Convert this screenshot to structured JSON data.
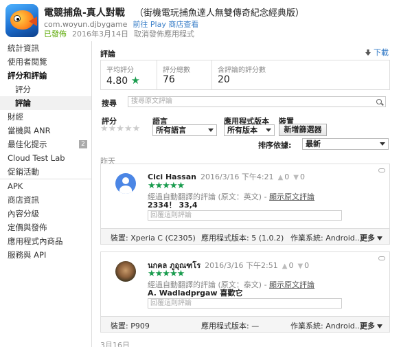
{
  "app": {
    "title": "電競捕魚-真人對戰",
    "subtitle": "（街機電玩捕魚達人無雙傳奇紀念經典版）",
    "package": "com.woyun.djbygame",
    "play_link": "前往 Play 商店查看",
    "status": "已發佈",
    "date": "2016年3月14日",
    "unpublish": "取消發佈應用程式"
  },
  "sidebar": {
    "items": [
      {
        "label": "統計資訊"
      },
      {
        "label": "使用者閱覽"
      },
      {
        "label": "評分和評論"
      },
      {
        "label": "評分"
      },
      {
        "label": "評論"
      },
      {
        "label": "財經"
      },
      {
        "label": "當機與 ANR"
      },
      {
        "label": "最佳化提示",
        "badge": "2"
      },
      {
        "label": "Cloud Test Lab"
      },
      {
        "label": "促銷活動"
      },
      {
        "label": "APK"
      },
      {
        "label": "商店資訊"
      },
      {
        "label": "內容分級"
      },
      {
        "label": "定價與發佈"
      },
      {
        "label": "應用程式內商品"
      },
      {
        "label": "服務與 API"
      }
    ]
  },
  "reviews_section": {
    "title": "評論",
    "download": "下載",
    "stats": [
      {
        "label": "平均評分",
        "value": "4.80",
        "star": "★"
      },
      {
        "label": "評分總數",
        "value": "76"
      },
      {
        "label": "含評論的評分數",
        "value": "20"
      }
    ],
    "search": {
      "label": "搜尋",
      "placeholder": "搜尋原文評論"
    },
    "filters": {
      "rating_label": "評分",
      "rating_stars": "★★★★★",
      "language_label": "語言",
      "language_value": "所有語言",
      "version_label": "應用程式版本",
      "version_value": "所有版本",
      "device_label": "裝置",
      "device_button": "新增篩選器",
      "sort_label": "排序依據:",
      "sort_value": "最新"
    },
    "day_labels": [
      "昨天",
      "3月16日"
    ]
  },
  "reviews": [
    {
      "name": "Cici Hassan",
      "date": "2016/3/16 下午4:21",
      "thumbs_up": "0",
      "thumbs_down": "0",
      "stars": "★★★★★",
      "translated_note": "經過自動翻譯的評論 (原文：英文) - ",
      "show_original": "顯示原文評論",
      "text": "2334！ 33,4",
      "reply_placeholder": "回覆這則評論",
      "device": "裝置: Xperia C (C2305)",
      "version": "應用程式版本: 5 (1.0.2)",
      "os": "作業系統: Android...",
      "more": "更多"
    },
    {
      "name": "นกคล ภูอุณฑโร",
      "date": "2016/3/16 下午2:51",
      "thumbs_up": "0",
      "thumbs_down": "0",
      "stars": "★★★★★",
      "translated_note": "經過自動翻譯的評論 (原文：泰文) - ",
      "show_original": "顯示原文評論",
      "text": "A. Wadladprgaw 喜歡它",
      "reply_placeholder": "回覆這則評論",
      "device": "裝置: P909",
      "version": "應用程式版本: —",
      "os": "作業系統: Android...",
      "more": "更多"
    }
  ]
}
